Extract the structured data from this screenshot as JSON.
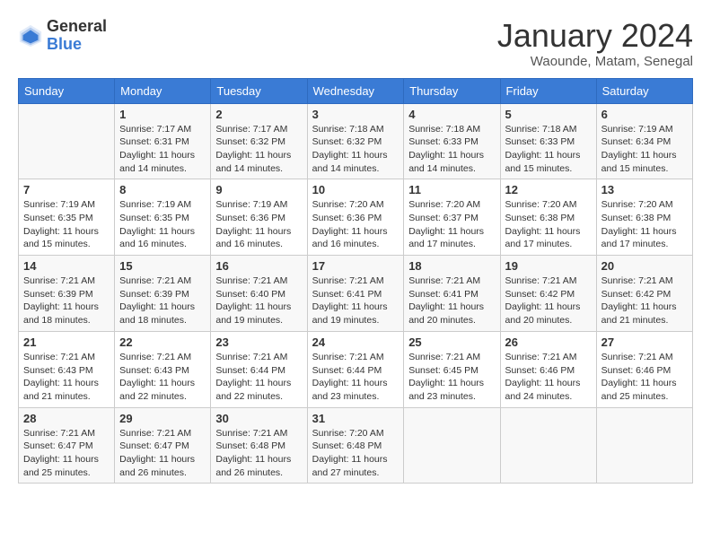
{
  "logo": {
    "general": "General",
    "blue": "Blue"
  },
  "title": "January 2024",
  "location": "Waounde, Matam, Senegal",
  "days_of_week": [
    "Sunday",
    "Monday",
    "Tuesday",
    "Wednesday",
    "Thursday",
    "Friday",
    "Saturday"
  ],
  "weeks": [
    [
      {
        "day": "",
        "sunrise": "",
        "sunset": "",
        "daylight": ""
      },
      {
        "day": "1",
        "sunrise": "Sunrise: 7:17 AM",
        "sunset": "Sunset: 6:31 PM",
        "daylight": "Daylight: 11 hours and 14 minutes."
      },
      {
        "day": "2",
        "sunrise": "Sunrise: 7:17 AM",
        "sunset": "Sunset: 6:32 PM",
        "daylight": "Daylight: 11 hours and 14 minutes."
      },
      {
        "day": "3",
        "sunrise": "Sunrise: 7:18 AM",
        "sunset": "Sunset: 6:32 PM",
        "daylight": "Daylight: 11 hours and 14 minutes."
      },
      {
        "day": "4",
        "sunrise": "Sunrise: 7:18 AM",
        "sunset": "Sunset: 6:33 PM",
        "daylight": "Daylight: 11 hours and 14 minutes."
      },
      {
        "day": "5",
        "sunrise": "Sunrise: 7:18 AM",
        "sunset": "Sunset: 6:33 PM",
        "daylight": "Daylight: 11 hours and 15 minutes."
      },
      {
        "day": "6",
        "sunrise": "Sunrise: 7:19 AM",
        "sunset": "Sunset: 6:34 PM",
        "daylight": "Daylight: 11 hours and 15 minutes."
      }
    ],
    [
      {
        "day": "7",
        "sunrise": "Sunrise: 7:19 AM",
        "sunset": "Sunset: 6:35 PM",
        "daylight": "Daylight: 11 hours and 15 minutes."
      },
      {
        "day": "8",
        "sunrise": "Sunrise: 7:19 AM",
        "sunset": "Sunset: 6:35 PM",
        "daylight": "Daylight: 11 hours and 16 minutes."
      },
      {
        "day": "9",
        "sunrise": "Sunrise: 7:19 AM",
        "sunset": "Sunset: 6:36 PM",
        "daylight": "Daylight: 11 hours and 16 minutes."
      },
      {
        "day": "10",
        "sunrise": "Sunrise: 7:20 AM",
        "sunset": "Sunset: 6:36 PM",
        "daylight": "Daylight: 11 hours and 16 minutes."
      },
      {
        "day": "11",
        "sunrise": "Sunrise: 7:20 AM",
        "sunset": "Sunset: 6:37 PM",
        "daylight": "Daylight: 11 hours and 17 minutes."
      },
      {
        "day": "12",
        "sunrise": "Sunrise: 7:20 AM",
        "sunset": "Sunset: 6:38 PM",
        "daylight": "Daylight: 11 hours and 17 minutes."
      },
      {
        "day": "13",
        "sunrise": "Sunrise: 7:20 AM",
        "sunset": "Sunset: 6:38 PM",
        "daylight": "Daylight: 11 hours and 17 minutes."
      }
    ],
    [
      {
        "day": "14",
        "sunrise": "Sunrise: 7:21 AM",
        "sunset": "Sunset: 6:39 PM",
        "daylight": "Daylight: 11 hours and 18 minutes."
      },
      {
        "day": "15",
        "sunrise": "Sunrise: 7:21 AM",
        "sunset": "Sunset: 6:39 PM",
        "daylight": "Daylight: 11 hours and 18 minutes."
      },
      {
        "day": "16",
        "sunrise": "Sunrise: 7:21 AM",
        "sunset": "Sunset: 6:40 PM",
        "daylight": "Daylight: 11 hours and 19 minutes."
      },
      {
        "day": "17",
        "sunrise": "Sunrise: 7:21 AM",
        "sunset": "Sunset: 6:41 PM",
        "daylight": "Daylight: 11 hours and 19 minutes."
      },
      {
        "day": "18",
        "sunrise": "Sunrise: 7:21 AM",
        "sunset": "Sunset: 6:41 PM",
        "daylight": "Daylight: 11 hours and 20 minutes."
      },
      {
        "day": "19",
        "sunrise": "Sunrise: 7:21 AM",
        "sunset": "Sunset: 6:42 PM",
        "daylight": "Daylight: 11 hours and 20 minutes."
      },
      {
        "day": "20",
        "sunrise": "Sunrise: 7:21 AM",
        "sunset": "Sunset: 6:42 PM",
        "daylight": "Daylight: 11 hours and 21 minutes."
      }
    ],
    [
      {
        "day": "21",
        "sunrise": "Sunrise: 7:21 AM",
        "sunset": "Sunset: 6:43 PM",
        "daylight": "Daylight: 11 hours and 21 minutes."
      },
      {
        "day": "22",
        "sunrise": "Sunrise: 7:21 AM",
        "sunset": "Sunset: 6:43 PM",
        "daylight": "Daylight: 11 hours and 22 minutes."
      },
      {
        "day": "23",
        "sunrise": "Sunrise: 7:21 AM",
        "sunset": "Sunset: 6:44 PM",
        "daylight": "Daylight: 11 hours and 22 minutes."
      },
      {
        "day": "24",
        "sunrise": "Sunrise: 7:21 AM",
        "sunset": "Sunset: 6:44 PM",
        "daylight": "Daylight: 11 hours and 23 minutes."
      },
      {
        "day": "25",
        "sunrise": "Sunrise: 7:21 AM",
        "sunset": "Sunset: 6:45 PM",
        "daylight": "Daylight: 11 hours and 23 minutes."
      },
      {
        "day": "26",
        "sunrise": "Sunrise: 7:21 AM",
        "sunset": "Sunset: 6:46 PM",
        "daylight": "Daylight: 11 hours and 24 minutes."
      },
      {
        "day": "27",
        "sunrise": "Sunrise: 7:21 AM",
        "sunset": "Sunset: 6:46 PM",
        "daylight": "Daylight: 11 hours and 25 minutes."
      }
    ],
    [
      {
        "day": "28",
        "sunrise": "Sunrise: 7:21 AM",
        "sunset": "Sunset: 6:47 PM",
        "daylight": "Daylight: 11 hours and 25 minutes."
      },
      {
        "day": "29",
        "sunrise": "Sunrise: 7:21 AM",
        "sunset": "Sunset: 6:47 PM",
        "daylight": "Daylight: 11 hours and 26 minutes."
      },
      {
        "day": "30",
        "sunrise": "Sunrise: 7:21 AM",
        "sunset": "Sunset: 6:48 PM",
        "daylight": "Daylight: 11 hours and 26 minutes."
      },
      {
        "day": "31",
        "sunrise": "Sunrise: 7:20 AM",
        "sunset": "Sunset: 6:48 PM",
        "daylight": "Daylight: 11 hours and 27 minutes."
      },
      {
        "day": "",
        "sunrise": "",
        "sunset": "",
        "daylight": ""
      },
      {
        "day": "",
        "sunrise": "",
        "sunset": "",
        "daylight": ""
      },
      {
        "day": "",
        "sunrise": "",
        "sunset": "",
        "daylight": ""
      }
    ]
  ]
}
